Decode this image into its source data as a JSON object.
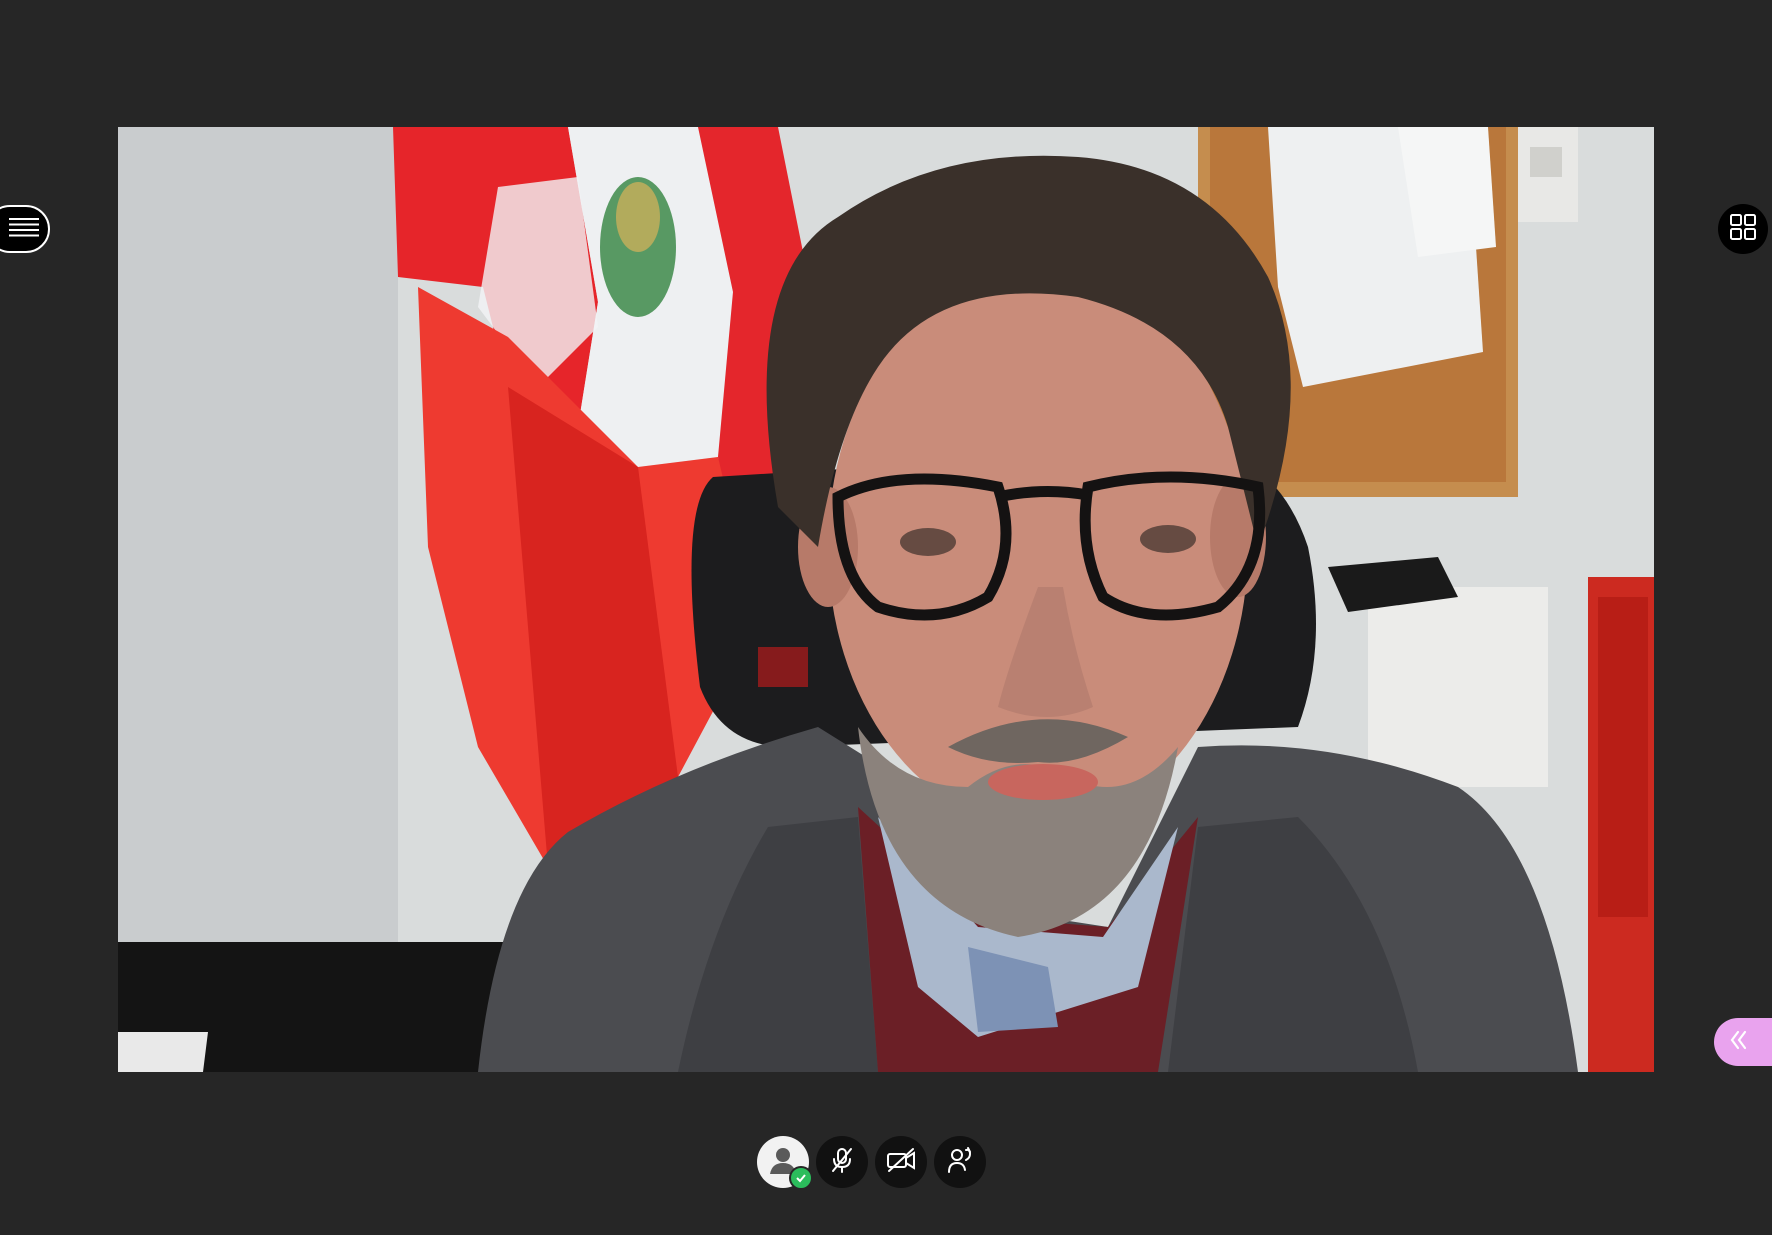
{
  "app": {
    "name": "video-conference"
  },
  "theme": {
    "background": "#262626",
    "accent_panel_toggle": "#e9a3ee",
    "status_online": "#2bbd5c",
    "control_bg": "#111111"
  },
  "video": {
    "participant_state": "speaking",
    "camera": "on"
  },
  "toolbar": {
    "buttons": [
      {
        "icon": "user-avatar-icon",
        "status": "online"
      },
      {
        "icon": "microphone-muted-icon"
      },
      {
        "icon": "camera-off-icon"
      },
      {
        "icon": "raise-hand-icon"
      }
    ]
  },
  "side_controls": {
    "menu": {
      "icon": "hamburger-menu-icon"
    },
    "layout": {
      "icon": "grid-layout-icon"
    },
    "panel": {
      "icon": "double-chevron-left-icon"
    }
  }
}
